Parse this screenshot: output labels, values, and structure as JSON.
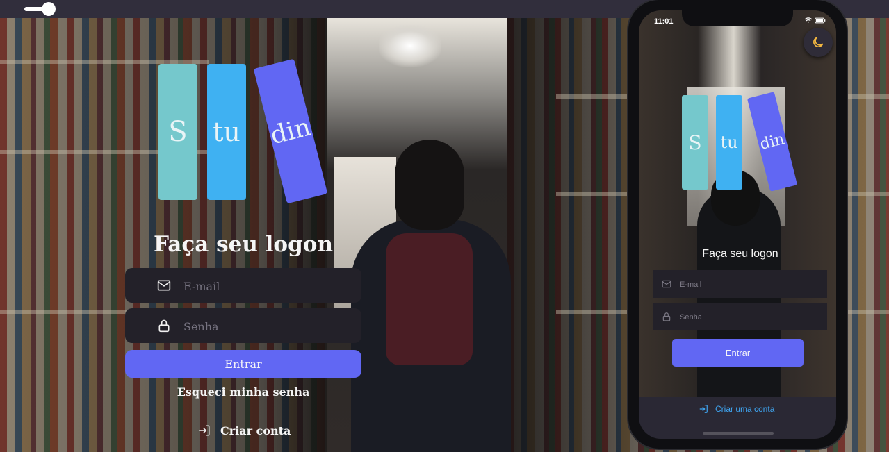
{
  "web": {
    "logo": {
      "letters": [
        "S",
        "tu",
        "din"
      ]
    },
    "title": "Faça seu logon",
    "email_placeholder": "E-mail",
    "password_placeholder": "Senha",
    "submit_label": "Entrar",
    "forgot_label": "Esqueci minha senha",
    "create_label": "Criar conta"
  },
  "mobile": {
    "status_time": "11:01",
    "logo": {
      "letters": [
        "S",
        "tu",
        "din"
      ]
    },
    "title": "Faça seu logon",
    "email_placeholder": "E-mail",
    "password_placeholder": "Senha",
    "submit_label": "Entrar",
    "create_label": "Criar uma conta"
  },
  "icons": [
    "theme-toggle",
    "mail-icon",
    "lock-icon",
    "log-in-icon",
    "moon-icon",
    "wifi-icon",
    "battery-icon"
  ],
  "colors": {
    "accent": "#6167f3",
    "book_teal": "#75c8cc",
    "book_blue": "#3fb1f2",
    "input_bg": "#232129",
    "link_blue": "#3fa6f2"
  }
}
